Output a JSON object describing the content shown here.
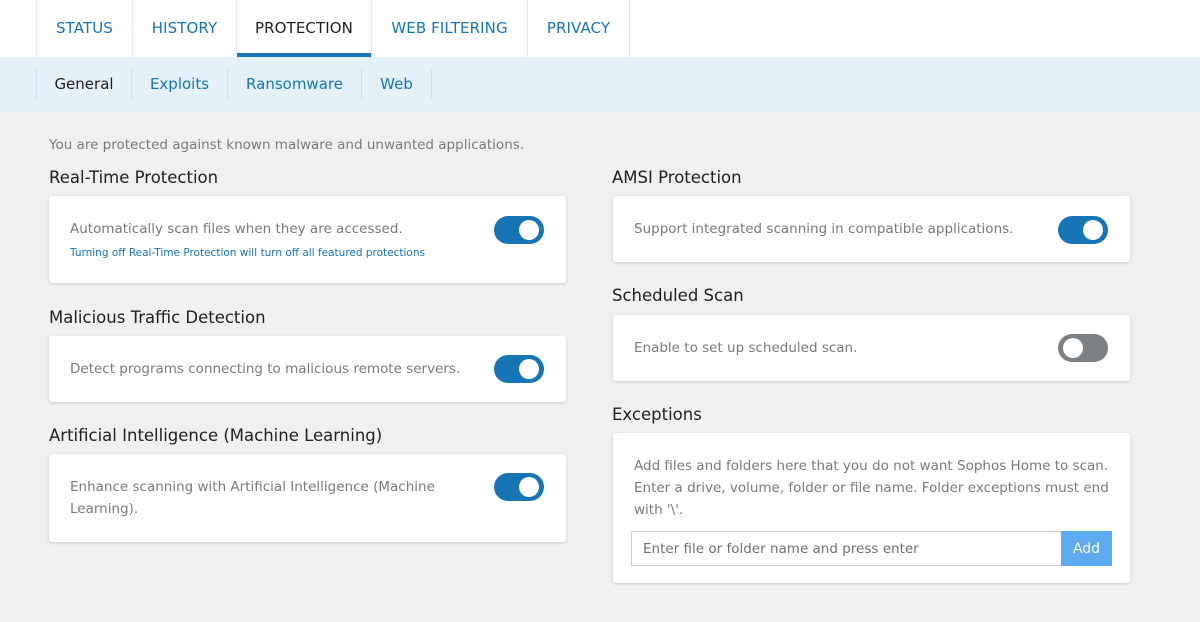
{
  "top_tabs": [
    {
      "label": "STATUS"
    },
    {
      "label": "HISTORY"
    },
    {
      "label": "PROTECTION"
    },
    {
      "label": "WEB FILTERING"
    },
    {
      "label": "PRIVACY"
    }
  ],
  "sub_tabs": [
    {
      "label": "General"
    },
    {
      "label": "Exploits"
    },
    {
      "label": "Ransomware"
    },
    {
      "label": "Web"
    }
  ],
  "intro": "You are protected against known malware and unwanted applications.",
  "realtime": {
    "title": "Real-Time Protection",
    "desc": "Automatically scan files when they are accessed.",
    "note": "Turning off Real-Time Protection will turn off all featured protections",
    "enabled": true
  },
  "malicious": {
    "title": "Malicious Traffic Detection",
    "desc": "Detect programs connecting to malicious remote servers.",
    "enabled": true
  },
  "ai": {
    "title": "Artificial Intelligence (Machine Learning)",
    "desc_line1": "Enhance scanning with Artificial Intelligence (Machine",
    "desc_line2": "Learning).",
    "enabled": true
  },
  "amsi": {
    "title": "AMSI Protection",
    "desc": "Support integrated scanning in compatible applications.",
    "enabled": true
  },
  "scheduled": {
    "title": "Scheduled Scan",
    "desc": "Enable to set up scheduled scan.",
    "enabled": false
  },
  "exceptions": {
    "title": "Exceptions",
    "desc_line1": "Add files and folders here that you do not want Sophos Home to scan.",
    "desc_line2": "Enter a drive, volume, folder or file name. Folder exceptions must end",
    "desc_line3": "with '\\'.",
    "input_value": "",
    "input_placeholder": "Enter file or folder name and press enter",
    "add_label": "Add"
  },
  "colors": {
    "accent": "#1775b6",
    "toggle_off": "#7c7f83",
    "add_button": "#5caaf0",
    "subnav_bg": "#e4f1f9",
    "page_bg": "#eff0f2"
  }
}
